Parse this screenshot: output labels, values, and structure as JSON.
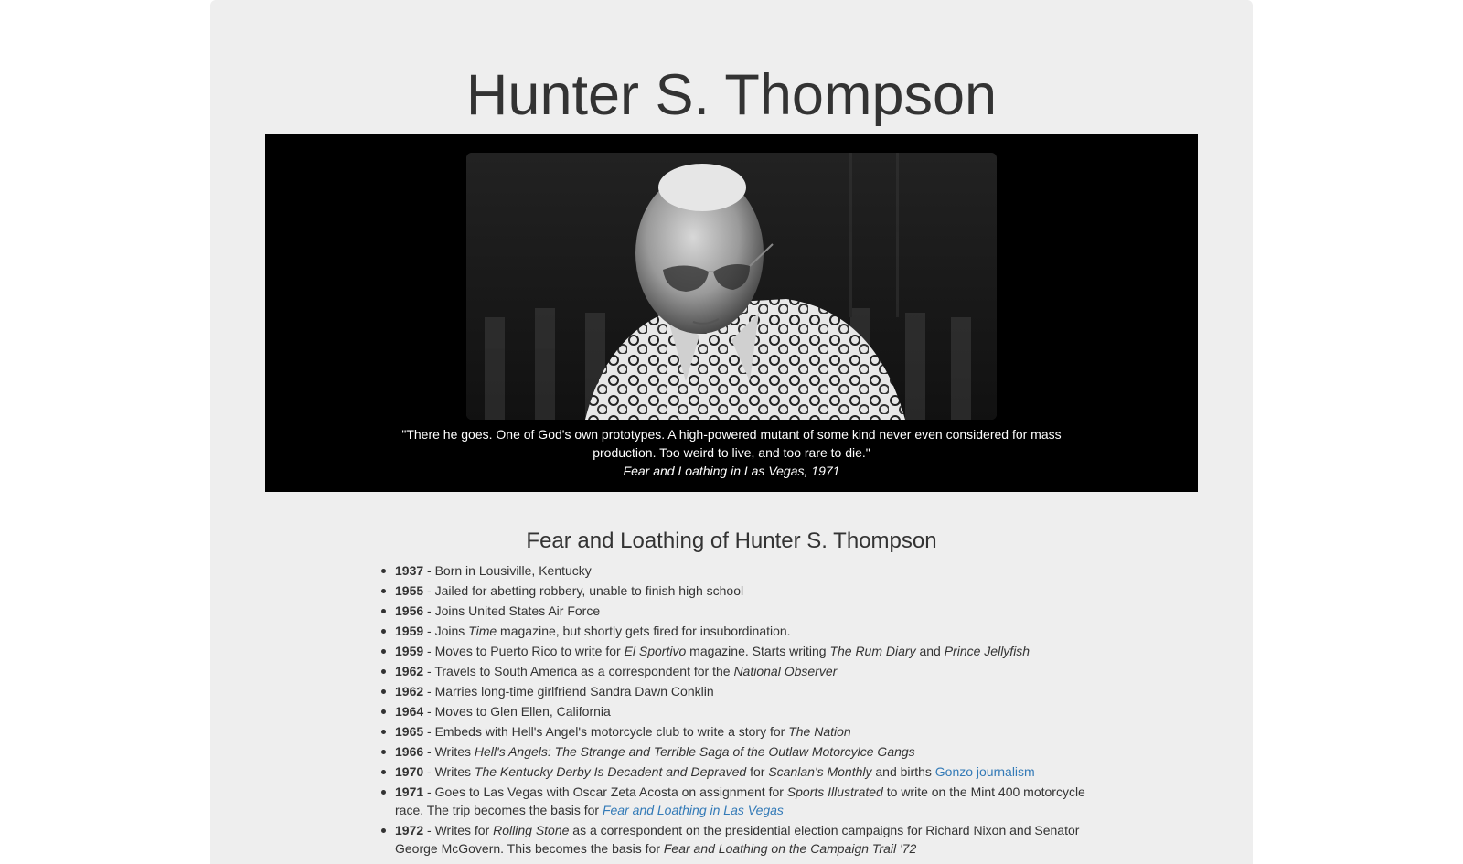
{
  "page": {
    "title": "Hunter S. Thompson"
  },
  "hero": {
    "image_alt": "Hunter S. Thompson wearing aviator sunglasses and a patterned shirt, looking down",
    "quote": "\"There he goes. One of God's own prototypes. A high-powered mutant of some kind never even considered for mass production. Too weird to live, and too rare to die.\"",
    "source": "Fear and Loathing in Las Vegas, 1971"
  },
  "timeline": {
    "heading": "Fear and Loathing of Hunter S. Thompson",
    "items": [
      {
        "year": "1937",
        "parts": [
          {
            "t": " - Born in Lousiville, Kentucky"
          }
        ]
      },
      {
        "year": "1955",
        "parts": [
          {
            "t": " - Jailed for abetting robbery, unable to finish high school"
          }
        ]
      },
      {
        "year": "1956",
        "parts": [
          {
            "t": " - Joins United States Air Force"
          }
        ]
      },
      {
        "year": "1959",
        "parts": [
          {
            "t": " - Joins "
          },
          {
            "t": "Time",
            "i": true
          },
          {
            "t": " magazine, but shortly gets fired for insubordination."
          }
        ]
      },
      {
        "year": "1959",
        "parts": [
          {
            "t": " - Moves to Puerto Rico to write for "
          },
          {
            "t": "El Sportivo",
            "i": true
          },
          {
            "t": " magazine. Starts writing "
          },
          {
            "t": "The Rum Diary",
            "i": true
          },
          {
            "t": " and "
          },
          {
            "t": "Prince Jellyfish",
            "i": true
          }
        ]
      },
      {
        "year": "1962",
        "parts": [
          {
            "t": " - Travels to South America as a correspondent for the "
          },
          {
            "t": "National Observer",
            "i": true
          }
        ]
      },
      {
        "year": "1962",
        "parts": [
          {
            "t": " - Marries long-time girlfriend Sandra Dawn Conklin"
          }
        ]
      },
      {
        "year": "1964",
        "parts": [
          {
            "t": " - Moves to Glen Ellen, California"
          }
        ]
      },
      {
        "year": "1965",
        "parts": [
          {
            "t": " - Embeds with Hell's Angel's motorcycle club to write a story for "
          },
          {
            "t": "The Nation",
            "i": true
          }
        ]
      },
      {
        "year": "1966",
        "parts": [
          {
            "t": " - Writes "
          },
          {
            "t": "Hell's Angels: The Strange and Terrible Saga of the Outlaw Motorcylce Gangs",
            "i": true
          }
        ]
      },
      {
        "year": "1970",
        "parts": [
          {
            "t": " - Writes "
          },
          {
            "t": "The Kentucky Derby Is Decadent and Depraved",
            "i": true
          },
          {
            "t": " for "
          },
          {
            "t": "Scanlan's Monthly",
            "i": true
          },
          {
            "t": " and births "
          },
          {
            "t": "Gonzo journalism",
            "link": true
          }
        ]
      },
      {
        "year": "1971",
        "parts": [
          {
            "t": " - Goes to Las Vegas with Oscar Zeta Acosta on assignment for "
          },
          {
            "t": "Sports Illustrated",
            "i": true
          },
          {
            "t": " to write on the Mint 400 motorcycle race. The trip becomes the basis for "
          },
          {
            "t": "Fear and Loathing in Las Vegas",
            "i": true,
            "link": true
          }
        ]
      },
      {
        "year": "1972",
        "parts": [
          {
            "t": " - Writes for "
          },
          {
            "t": "Rolling Stone",
            "i": true
          },
          {
            "t": " as a correspondent on the presidential election campaigns for Richard Nixon and Senator George McGovern. This becomes the basis for "
          },
          {
            "t": "Fear and Loathing on the Campaign Trail '72",
            "i": true
          }
        ]
      }
    ]
  },
  "colors": {
    "page_bg": "#ffffff",
    "container_bg": "#eeeeee",
    "text": "#333333",
    "panel_bg": "#000000",
    "link": "#337ab7"
  }
}
